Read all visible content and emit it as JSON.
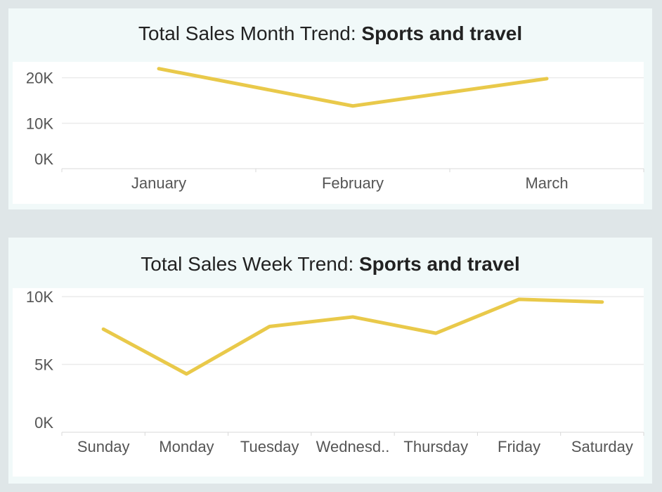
{
  "charts": {
    "month": {
      "title_prefix": "Total Sales Month Trend: ",
      "title_bold": "Sports and travel"
    },
    "week": {
      "title_prefix": "Total Sales Week Trend: ",
      "title_bold": "Sports and travel"
    }
  },
  "colors": {
    "line": "#e9c94a",
    "grid": "#ebebeb",
    "axis_text": "#555555"
  },
  "chart_data": [
    {
      "type": "line",
      "title": "Total Sales Month Trend: Sports and travel",
      "categories": [
        "January",
        "February",
        "March"
      ],
      "values": [
        22000,
        13800,
        19800
      ],
      "yticks": [
        0,
        10000,
        20000
      ],
      "ytick_labels": [
        "0K",
        "10K",
        "20K"
      ],
      "ylim": [
        0,
        23500
      ],
      "grid": true
    },
    {
      "type": "line",
      "title": "Total Sales Week Trend: Sports and travel",
      "categories": [
        "Sunday",
        "Monday",
        "Tuesday",
        "Wednesd..",
        "Thursday",
        "Friday",
        "Saturday"
      ],
      "values": [
        7600,
        4300,
        7800,
        8500,
        7300,
        9800,
        9600
      ],
      "yticks": [
        0,
        5000,
        10000
      ],
      "ytick_labels": [
        "0K",
        "5K",
        "10K"
      ],
      "ylim": [
        0,
        10000
      ],
      "grid": true
    }
  ]
}
